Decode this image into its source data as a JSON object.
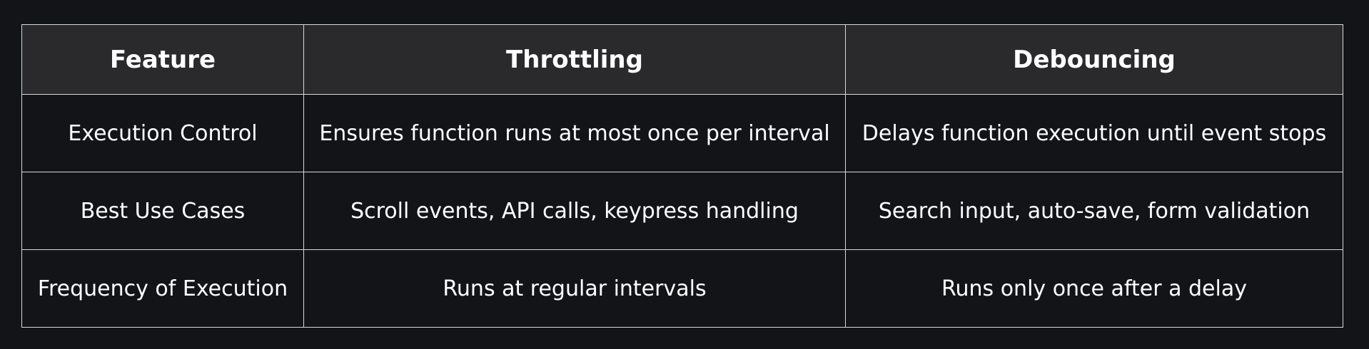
{
  "table": {
    "headers": [
      "Feature",
      "Throttling",
      "Debouncing"
    ],
    "rows": [
      [
        "Execution Control",
        "Ensures function runs at most once per interval",
        "Delays function execution until event stops"
      ],
      [
        "Best Use Cases",
        "Scroll events, API calls, keypress handling",
        "Search input, auto-save, form validation"
      ],
      [
        "Frequency of Execution",
        "Runs at regular intervals",
        "Runs only once after a delay"
      ]
    ]
  }
}
